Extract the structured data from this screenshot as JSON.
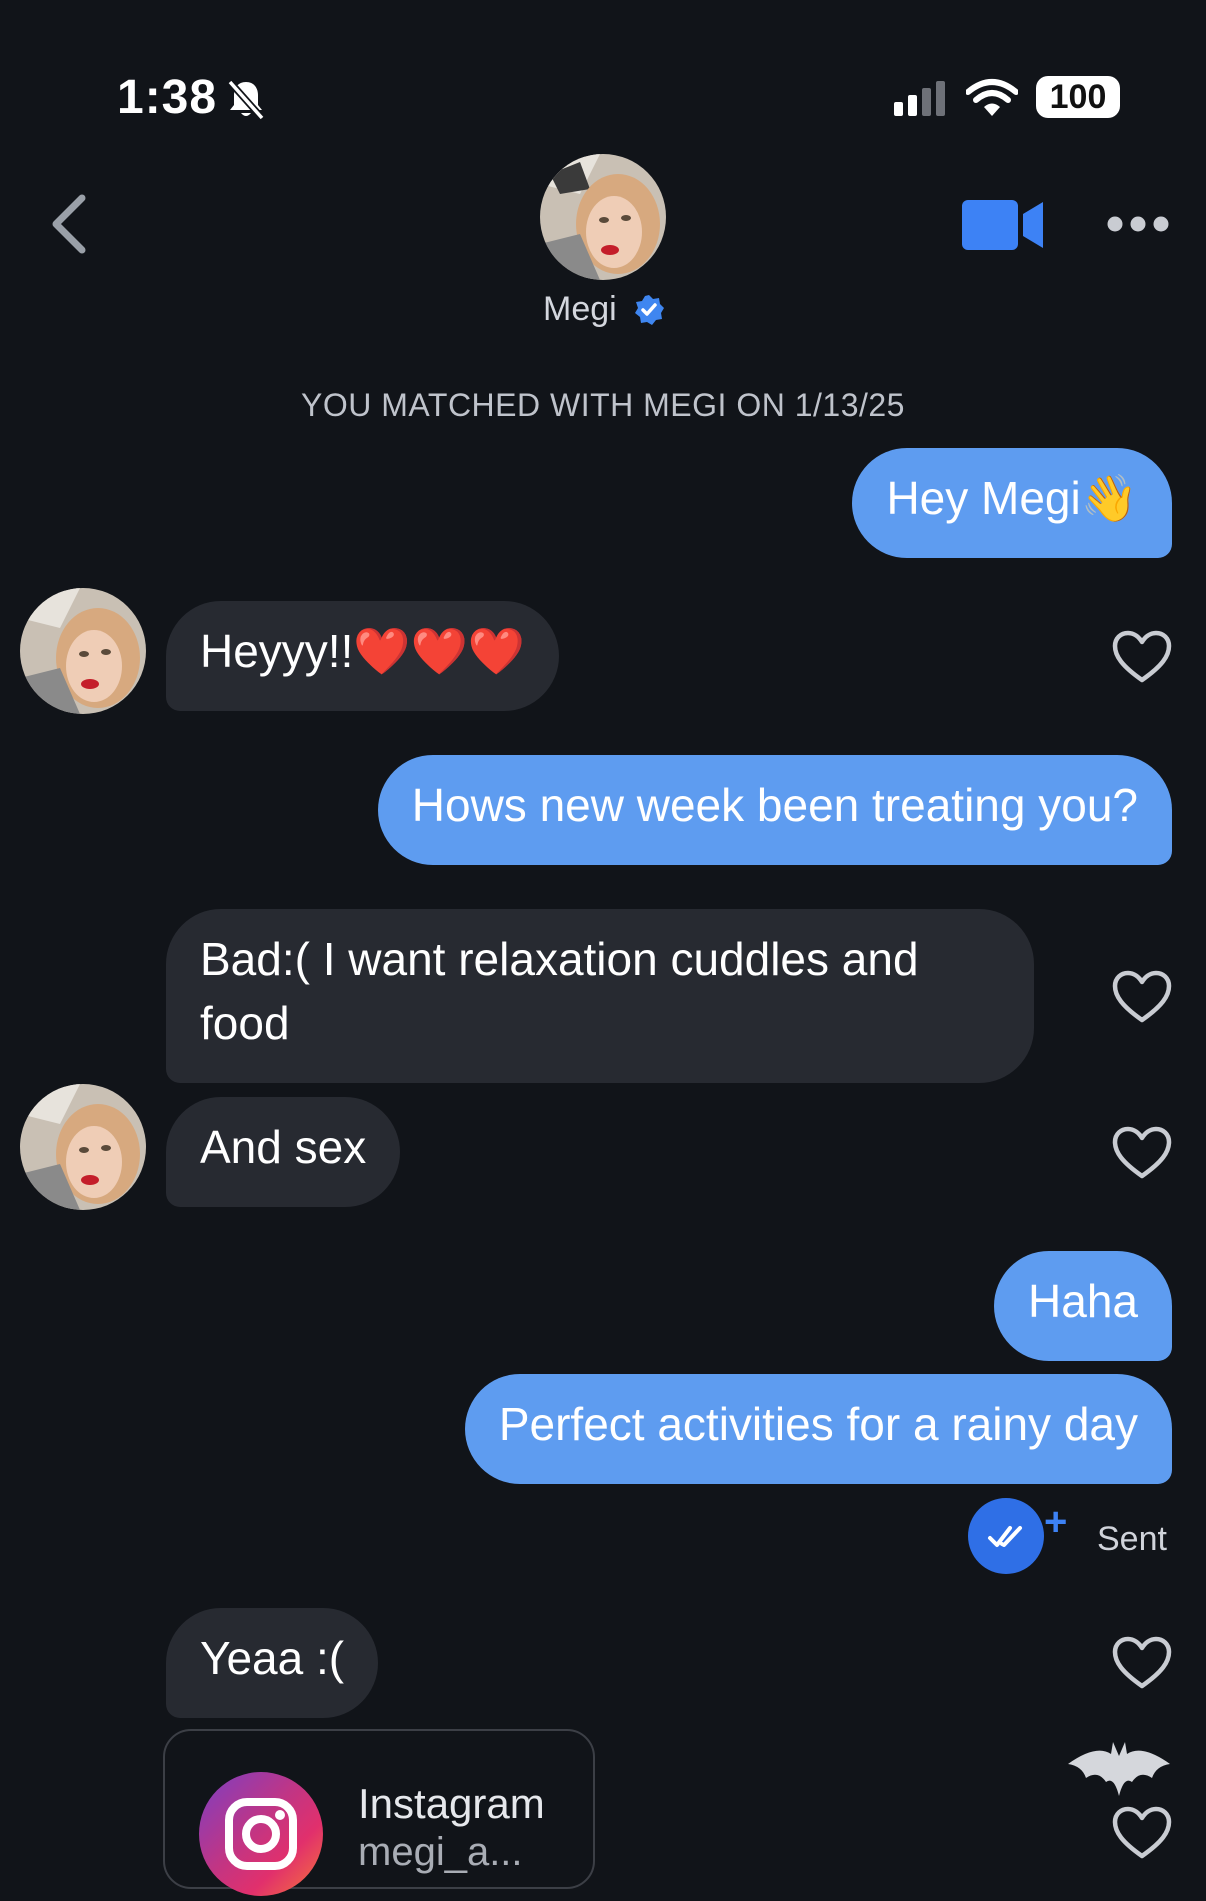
{
  "status_bar": {
    "time": "1:38",
    "battery": "100"
  },
  "header": {
    "name": "Megi"
  },
  "match_banner": "YOU MATCHED WITH MEGI ON 1/13/25",
  "messages": [
    {
      "from": "me",
      "text": "Hey Megi👋"
    },
    {
      "from": "them",
      "text": "Heyyy!!❤️❤️❤️"
    },
    {
      "from": "me",
      "text": "Hows new week been treating you?"
    },
    {
      "from": "them",
      "text": "Bad:( I want relaxation cuddles and food"
    },
    {
      "from": "them",
      "text": "And sex"
    },
    {
      "from": "me",
      "text": "Haha"
    },
    {
      "from": "me",
      "text": "Perfect activities for a rainy day"
    },
    {
      "from": "them",
      "text": "Yeaa :("
    }
  ],
  "sent_status": "Sent",
  "shared_card": {
    "title": "Instagram",
    "subtitle": "megi_a..."
  },
  "colors": {
    "background": "#111419",
    "outgoing": "#5e9cf0",
    "incoming": "#272a31",
    "accent": "#2f6fe6"
  }
}
